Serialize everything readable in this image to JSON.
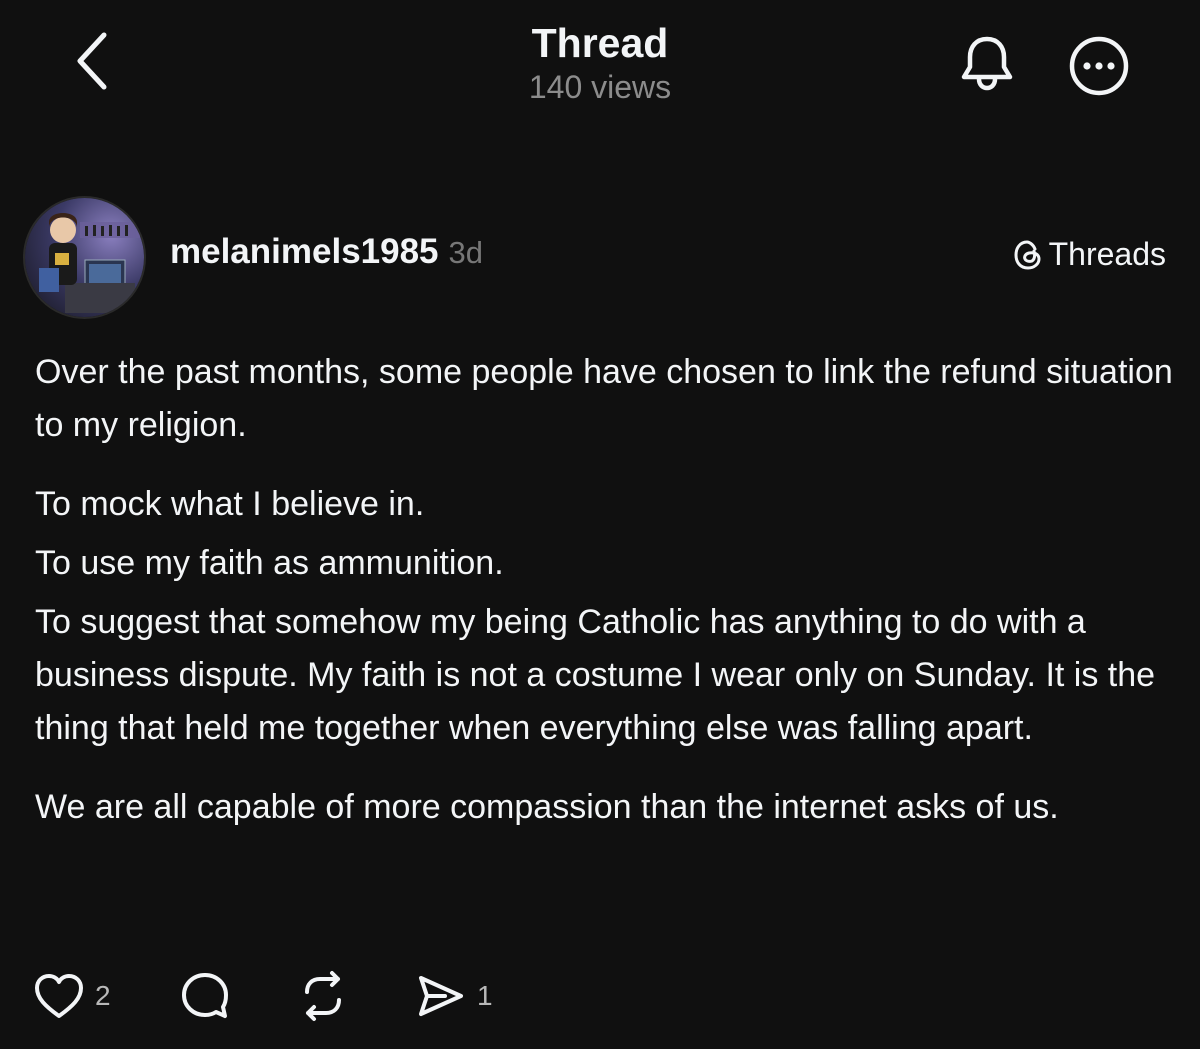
{
  "header": {
    "title": "Thread",
    "views": "140 views",
    "back_icon": "chevron-left-icon",
    "bell_icon": "bell-icon",
    "more_icon": "more-icon"
  },
  "post": {
    "username": "melanimels1985",
    "timestamp": "3d",
    "source_label": "Threads",
    "paragraphs": {
      "p1": "Over the past months, some people have chosen to link the refund situation to my religion.",
      "l1": "To mock what I believe in.",
      "l2": "To use my faith as ammunition.",
      "l3": "To suggest that somehow my being Catholic has anything to do with a business dispute. My faith is not a costume I wear only on Sunday. It is the thing that held me together when everything else was falling apart.",
      "p3": "We are all capable of more compassion than the internet asks of us."
    },
    "actions": {
      "like_count": "2",
      "comment_count": "",
      "repost_count": "",
      "share_count": "1"
    }
  },
  "colors": {
    "background": "#101010",
    "text": "#f3f5f7",
    "muted": "#777777"
  }
}
